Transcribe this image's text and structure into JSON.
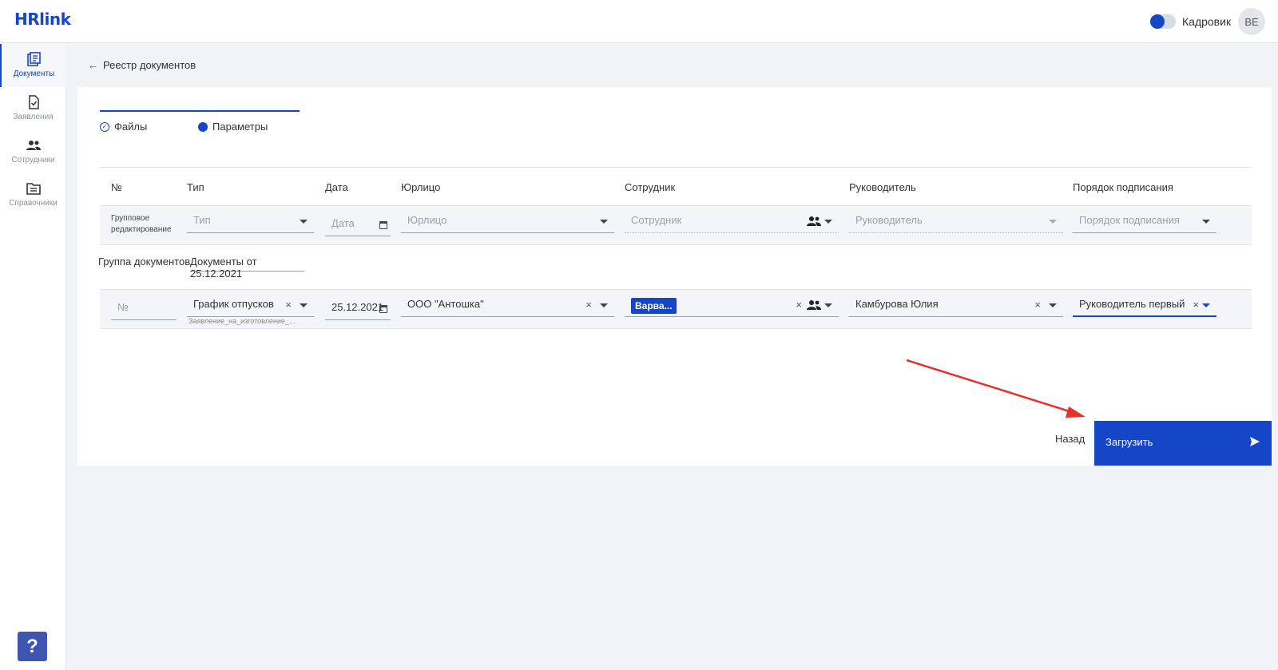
{
  "header": {
    "logo": "HRlink",
    "role_label": "Кадровик",
    "avatar_initials": "ВЕ"
  },
  "sidebar": {
    "items": [
      {
        "label": "Документы",
        "icon": "documents-icon",
        "active": true
      },
      {
        "label": "Заявления",
        "icon": "application-icon",
        "active": false
      },
      {
        "label": "Сотрудники",
        "icon": "employees-icon",
        "active": false
      },
      {
        "label": "Справочники",
        "icon": "folder-icon",
        "active": false
      }
    ],
    "help_label": "?"
  },
  "breadcrumb": {
    "back_label": "Реестр документов"
  },
  "stepper": {
    "steps": [
      {
        "label": "Файлы",
        "state": "done"
      },
      {
        "label": "Параметры",
        "state": "current"
      }
    ]
  },
  "table": {
    "columns": [
      "№",
      "Тип",
      "Дата",
      "Юрлицо",
      "Сотрудник",
      "Руководитель",
      "Порядок подписания"
    ],
    "group_edit": {
      "label_line1": "Групповое",
      "label_line2": "редактирование",
      "type_placeholder": "Тип",
      "date_placeholder": "Дата",
      "entity_placeholder": "Юрлицо",
      "employee_placeholder": "Сотрудник",
      "manager_placeholder": "Руководитель",
      "order_placeholder": "Порядок подписания"
    },
    "doc_group": {
      "label": "Группа документов",
      "value": "Документы от 25.12.2021"
    },
    "rows": [
      {
        "number_placeholder": "№",
        "type": "График отпусков",
        "type_sub": "Заявление_на_изготовление_...",
        "date": "25.12.2021",
        "entity": "ООО \"Антошка\"",
        "employee_chip": "Варва...",
        "manager": "Камбурова Юлия",
        "order": "Руководитель первый"
      }
    ]
  },
  "actions": {
    "back_label": "Назад",
    "upload_label": "Загрузить"
  },
  "colors": {
    "accent": "#1646c8",
    "annotation_arrow": "#e8312a"
  }
}
